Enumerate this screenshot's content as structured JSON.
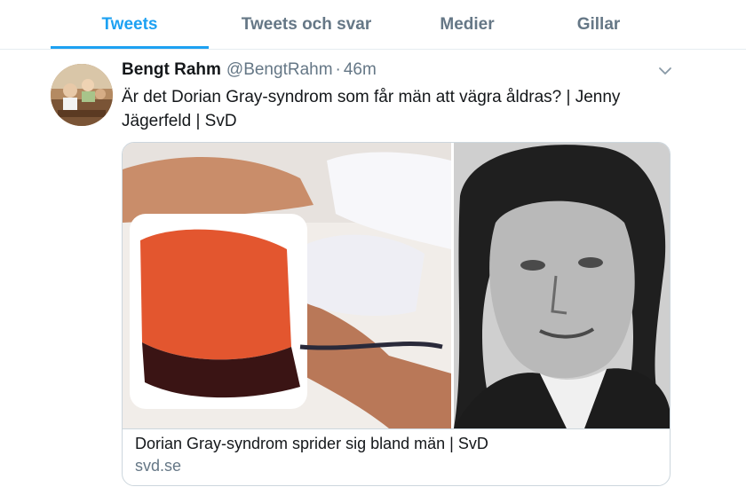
{
  "tabs": [
    {
      "label": "Tweets",
      "active": true
    },
    {
      "label": "Tweets och svar",
      "active": false
    },
    {
      "label": "Medier",
      "active": false
    },
    {
      "label": "Gillar",
      "active": false
    }
  ],
  "colors": {
    "accent": "#1da1f2",
    "secondary_text": "#657786",
    "border": "#e6ecf0"
  },
  "tweet": {
    "author_name": "Bengt Rahm",
    "handle": "@BengtRahm",
    "separator": "·",
    "time": "46m",
    "text": "Är det Dorian Gray-syndrom som får män att vägra åldras? | Jenny Jägerfeld | SvD",
    "menu_icon": "chevron-down-icon",
    "card": {
      "title": "Dorian Gray-syndrom sprider sig bland män | SvD",
      "domain": "svd.se"
    }
  }
}
